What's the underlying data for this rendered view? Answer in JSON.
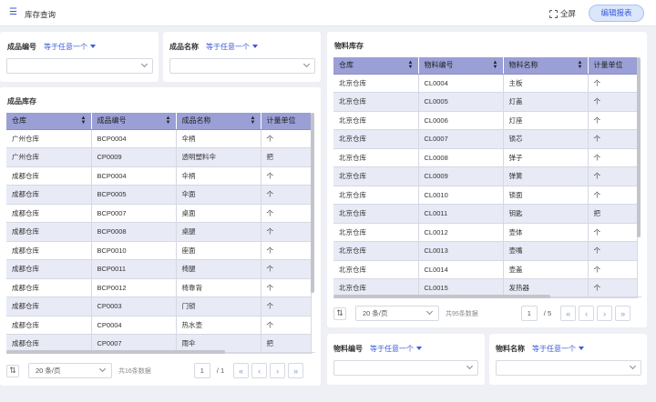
{
  "header": {
    "menu_icon": "☰",
    "title": "库存查询",
    "fullscreen_label": "全屏",
    "edit_report_label": "编辑报表"
  },
  "filters": {
    "product_code": {
      "label": "成品编号",
      "operator": "等于任意一个"
    },
    "product_name": {
      "label": "成品名称",
      "operator": "等于任意一个"
    },
    "material_code": {
      "label": "物料编号",
      "operator": "等于任意一个"
    },
    "material_name": {
      "label": "物料名称",
      "operator": "等于任意一个"
    }
  },
  "product_stock": {
    "title": "成品库存",
    "columns": [
      "仓库",
      "成品编号",
      "成品名称",
      "计量单位"
    ],
    "rows": [
      [
        "广州仓库",
        "BCP0004",
        "伞柄",
        "个"
      ],
      [
        "广州仓库",
        "CP0009",
        "透明塑料伞",
        "把"
      ],
      [
        "成都仓库",
        "BCP0004",
        "伞柄",
        "个"
      ],
      [
        "成都仓库",
        "BCP0005",
        "伞面",
        "个"
      ],
      [
        "成都仓库",
        "BCP0007",
        "桌面",
        "个"
      ],
      [
        "成都仓库",
        "BCP0008",
        "桌腿",
        "个"
      ],
      [
        "成都仓库",
        "BCP0010",
        "座面",
        "个"
      ],
      [
        "成都仓库",
        "BCP0011",
        "椅腿",
        "个"
      ],
      [
        "成都仓库",
        "BCP0012",
        "椅靠背",
        "个"
      ],
      [
        "成都仓库",
        "CP0003",
        "门锁",
        "个"
      ],
      [
        "成都仓库",
        "CP0004",
        "热水壶",
        "个"
      ],
      [
        "成都仓库",
        "CP0007",
        "雨伞",
        "把"
      ]
    ],
    "pager": {
      "page_size": "20 条/页",
      "total": "共16条数据",
      "page": "1",
      "pages": "/ 1"
    }
  },
  "material_stock": {
    "title": "物料库存",
    "columns": [
      "仓库",
      "物料编号",
      "物料名称",
      "计量单位"
    ],
    "rows": [
      [
        "北京仓库",
        "CL0004",
        "主板",
        "个"
      ],
      [
        "北京仓库",
        "CL0005",
        "灯盖",
        "个"
      ],
      [
        "北京仓库",
        "CL0006",
        "灯座",
        "个"
      ],
      [
        "北京仓库",
        "CL0007",
        "锁芯",
        "个"
      ],
      [
        "北京仓库",
        "CL0008",
        "弹子",
        "个"
      ],
      [
        "北京仓库",
        "CL0009",
        "弹簧",
        "个"
      ],
      [
        "北京仓库",
        "CL0010",
        "锁面",
        "个"
      ],
      [
        "北京仓库",
        "CL0011",
        "钥匙",
        "把"
      ],
      [
        "北京仓库",
        "CL0012",
        "壶体",
        "个"
      ],
      [
        "北京仓库",
        "CL0013",
        "壶嘴",
        "个"
      ],
      [
        "北京仓库",
        "CL0014",
        "壶盖",
        "个"
      ],
      [
        "北京仓库",
        "CL0015",
        "发热器",
        "个"
      ]
    ],
    "pager": {
      "page_size": "20 条/页",
      "total": "共95条数据",
      "page": "1",
      "pages": "/ 5"
    }
  }
}
